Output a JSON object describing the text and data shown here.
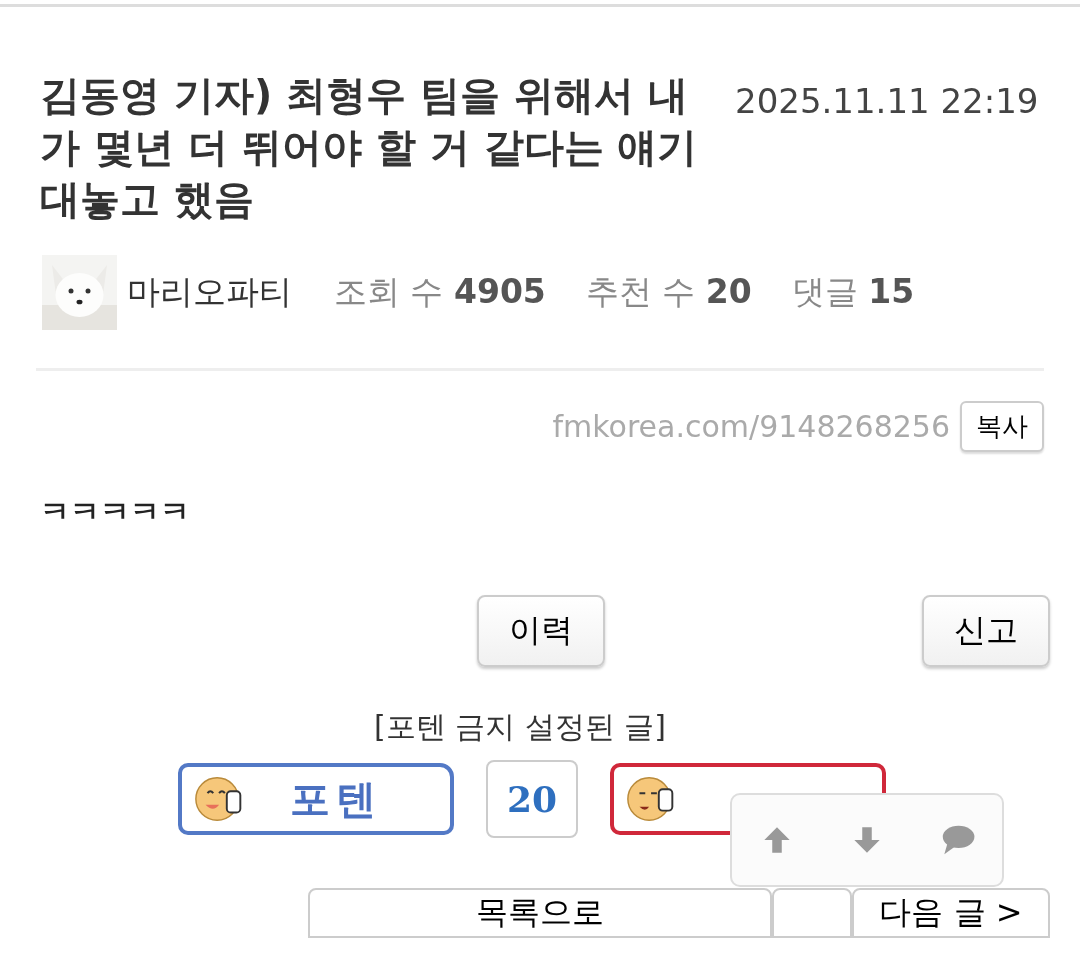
{
  "post": {
    "title": "김동영 기자) 최형우 팀을 위해서 내가 몇년 더 뛰어야 할 거 같다는 얘기 대놓고 했음",
    "date": "2025.11.11 22:19"
  },
  "author": {
    "name": "마리오파티"
  },
  "stats": [
    {
      "label": "조회 수",
      "value": "4905"
    },
    {
      "label": "추천 수",
      "value": "20"
    },
    {
      "label": "댓글",
      "value": "15"
    }
  ],
  "link": {
    "url": "fmkorea.com/9148268256",
    "copy_button": "복사"
  },
  "body": "ㅋㅋㅋㅋㅋ",
  "actions": [
    "이력",
    "신고"
  ],
  "notice": "[포텐 금지 설정된 글]",
  "vote": {
    "up_label": "포텐",
    "count": "20"
  },
  "floating_toolbar": [
    {
      "kind": "up"
    },
    {
      "kind": "down"
    },
    {
      "kind": "comment"
    }
  ],
  "nav": {
    "list_button": "목록으로",
    "next_button": "다음 글 >"
  }
}
